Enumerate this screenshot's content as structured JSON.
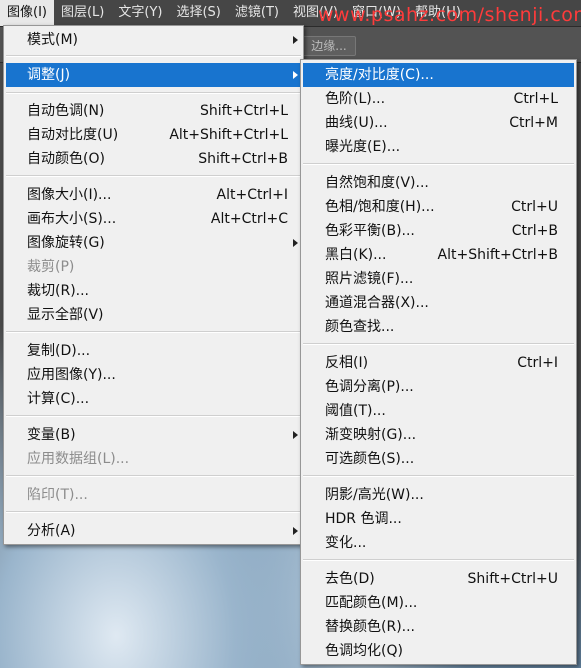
{
  "menubar": {
    "items": [
      "图像(I)",
      "图层(L)",
      "文字(Y)",
      "选择(S)",
      "滤镜(T)",
      "视图(V)",
      "窗口(W)",
      "帮助(H)"
    ],
    "watermark": "www.psahz.com/shenji.com"
  },
  "options_bar": {
    "refine_edge": "边缘..."
  },
  "image_menu": {
    "items": [
      {
        "label": "模式(M)",
        "shortcut": "",
        "submenu": true
      },
      {
        "label": "调整(J)",
        "shortcut": "",
        "submenu": true
      },
      {
        "label": "自动色调(N)",
        "shortcut": "Shift+Ctrl+L"
      },
      {
        "label": "自动对比度(U)",
        "shortcut": "Alt+Shift+Ctrl+L"
      },
      {
        "label": "自动颜色(O)",
        "shortcut": "Shift+Ctrl+B"
      },
      {
        "label": "图像大小(I)...",
        "shortcut": "Alt+Ctrl+I"
      },
      {
        "label": "画布大小(S)...",
        "shortcut": "Alt+Ctrl+C"
      },
      {
        "label": "图像旋转(G)",
        "shortcut": "",
        "submenu": true
      },
      {
        "label": "裁剪(P)",
        "shortcut": "",
        "disabled": true
      },
      {
        "label": "裁切(R)...",
        "shortcut": ""
      },
      {
        "label": "显示全部(V)",
        "shortcut": ""
      },
      {
        "label": "复制(D)...",
        "shortcut": ""
      },
      {
        "label": "应用图像(Y)...",
        "shortcut": ""
      },
      {
        "label": "计算(C)...",
        "shortcut": ""
      },
      {
        "label": "变量(B)",
        "shortcut": "",
        "submenu": true
      },
      {
        "label": "应用数据组(L)...",
        "shortcut": "",
        "disabled": true
      },
      {
        "label": "陷印(T)...",
        "shortcut": "",
        "disabled": true
      },
      {
        "label": "分析(A)",
        "shortcut": "",
        "submenu": true
      }
    ]
  },
  "adjust_menu": {
    "items": [
      {
        "label": "亮度/对比度(C)...",
        "shortcut": ""
      },
      {
        "label": "色阶(L)...",
        "shortcut": "Ctrl+L"
      },
      {
        "label": "曲线(U)...",
        "shortcut": "Ctrl+M"
      },
      {
        "label": "曝光度(E)...",
        "shortcut": ""
      },
      {
        "label": "自然饱和度(V)...",
        "shortcut": ""
      },
      {
        "label": "色相/饱和度(H)...",
        "shortcut": "Ctrl+U"
      },
      {
        "label": "色彩平衡(B)...",
        "shortcut": "Ctrl+B"
      },
      {
        "label": "黑白(K)...",
        "shortcut": "Alt+Shift+Ctrl+B"
      },
      {
        "label": "照片滤镜(F)...",
        "shortcut": ""
      },
      {
        "label": "通道混合器(X)...",
        "shortcut": ""
      },
      {
        "label": "颜色查找...",
        "shortcut": ""
      },
      {
        "label": "反相(I)",
        "shortcut": "Ctrl+I"
      },
      {
        "label": "色调分离(P)...",
        "shortcut": ""
      },
      {
        "label": "阈值(T)...",
        "shortcut": ""
      },
      {
        "label": "渐变映射(G)...",
        "shortcut": ""
      },
      {
        "label": "可选颜色(S)...",
        "shortcut": ""
      },
      {
        "label": "阴影/高光(W)...",
        "shortcut": ""
      },
      {
        "label": "HDR 色调...",
        "shortcut": ""
      },
      {
        "label": "变化...",
        "shortcut": ""
      },
      {
        "label": "去色(D)",
        "shortcut": "Shift+Ctrl+U"
      },
      {
        "label": "匹配颜色(M)...",
        "shortcut": ""
      },
      {
        "label": "替换颜色(R)...",
        "shortcut": ""
      },
      {
        "label": "色调均化(Q)",
        "shortcut": ""
      }
    ]
  },
  "colors": {
    "highlight": "#1874cf",
    "menu_bg": "#f0f0f0",
    "watermark": "#ff3b3b"
  }
}
